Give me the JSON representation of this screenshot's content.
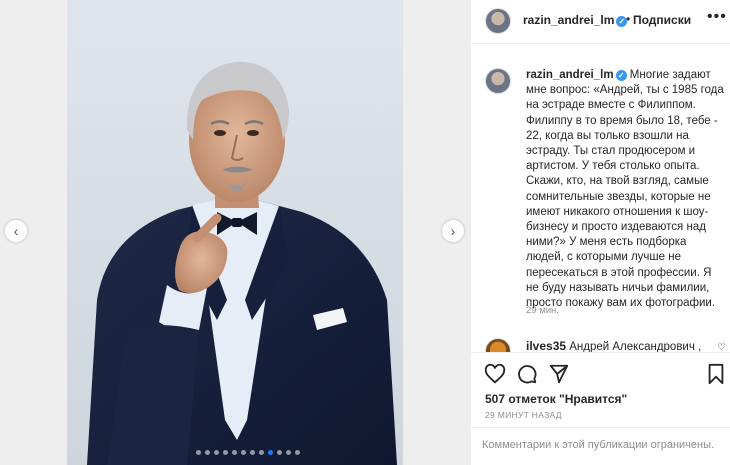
{
  "post": {
    "image_slide_count": 12,
    "active_slide_index": 8
  },
  "header": {
    "username": "razin_andrei_lm",
    "separator": "•",
    "follow_label": "Подписки",
    "more_label": "•••"
  },
  "caption": {
    "username": "razin_andrei_lm",
    "text": "Многие задают мне вопрос: «Андрей, ты с 1985 года на эстраде вместе с Филиппом. Филиппу в то время было 18, тебе - 22, когда вы только взошли на эстраду. Ты стал продюсером и артистом. У тебя столько опыта. Скажи, кто, на твой взгляд, самые сомнительные звезды, которые не имеют никакого отношения к шоу-бизнесу и просто издеваются над ними?» У меня есть подборка людей, с которыми лучше не пересекаться в этой профессии. Я не буду называть ничьи фамилии, просто покажу вам их фотографии.",
    "time_ago": "29 мин."
  },
  "comment": {
    "username": "ilves35",
    "text": "Андрей Александрович ,"
  },
  "actions": {
    "likes": "507 отметок \"Нравится\"",
    "posted": "29 МИНУТ НАЗАД",
    "comments_closed": "Комментарии к этой публикации ограничены."
  },
  "colors": {
    "accent": "#3897f0",
    "active_dot": "#1a7cf5",
    "muted": "#8e8e8e"
  }
}
